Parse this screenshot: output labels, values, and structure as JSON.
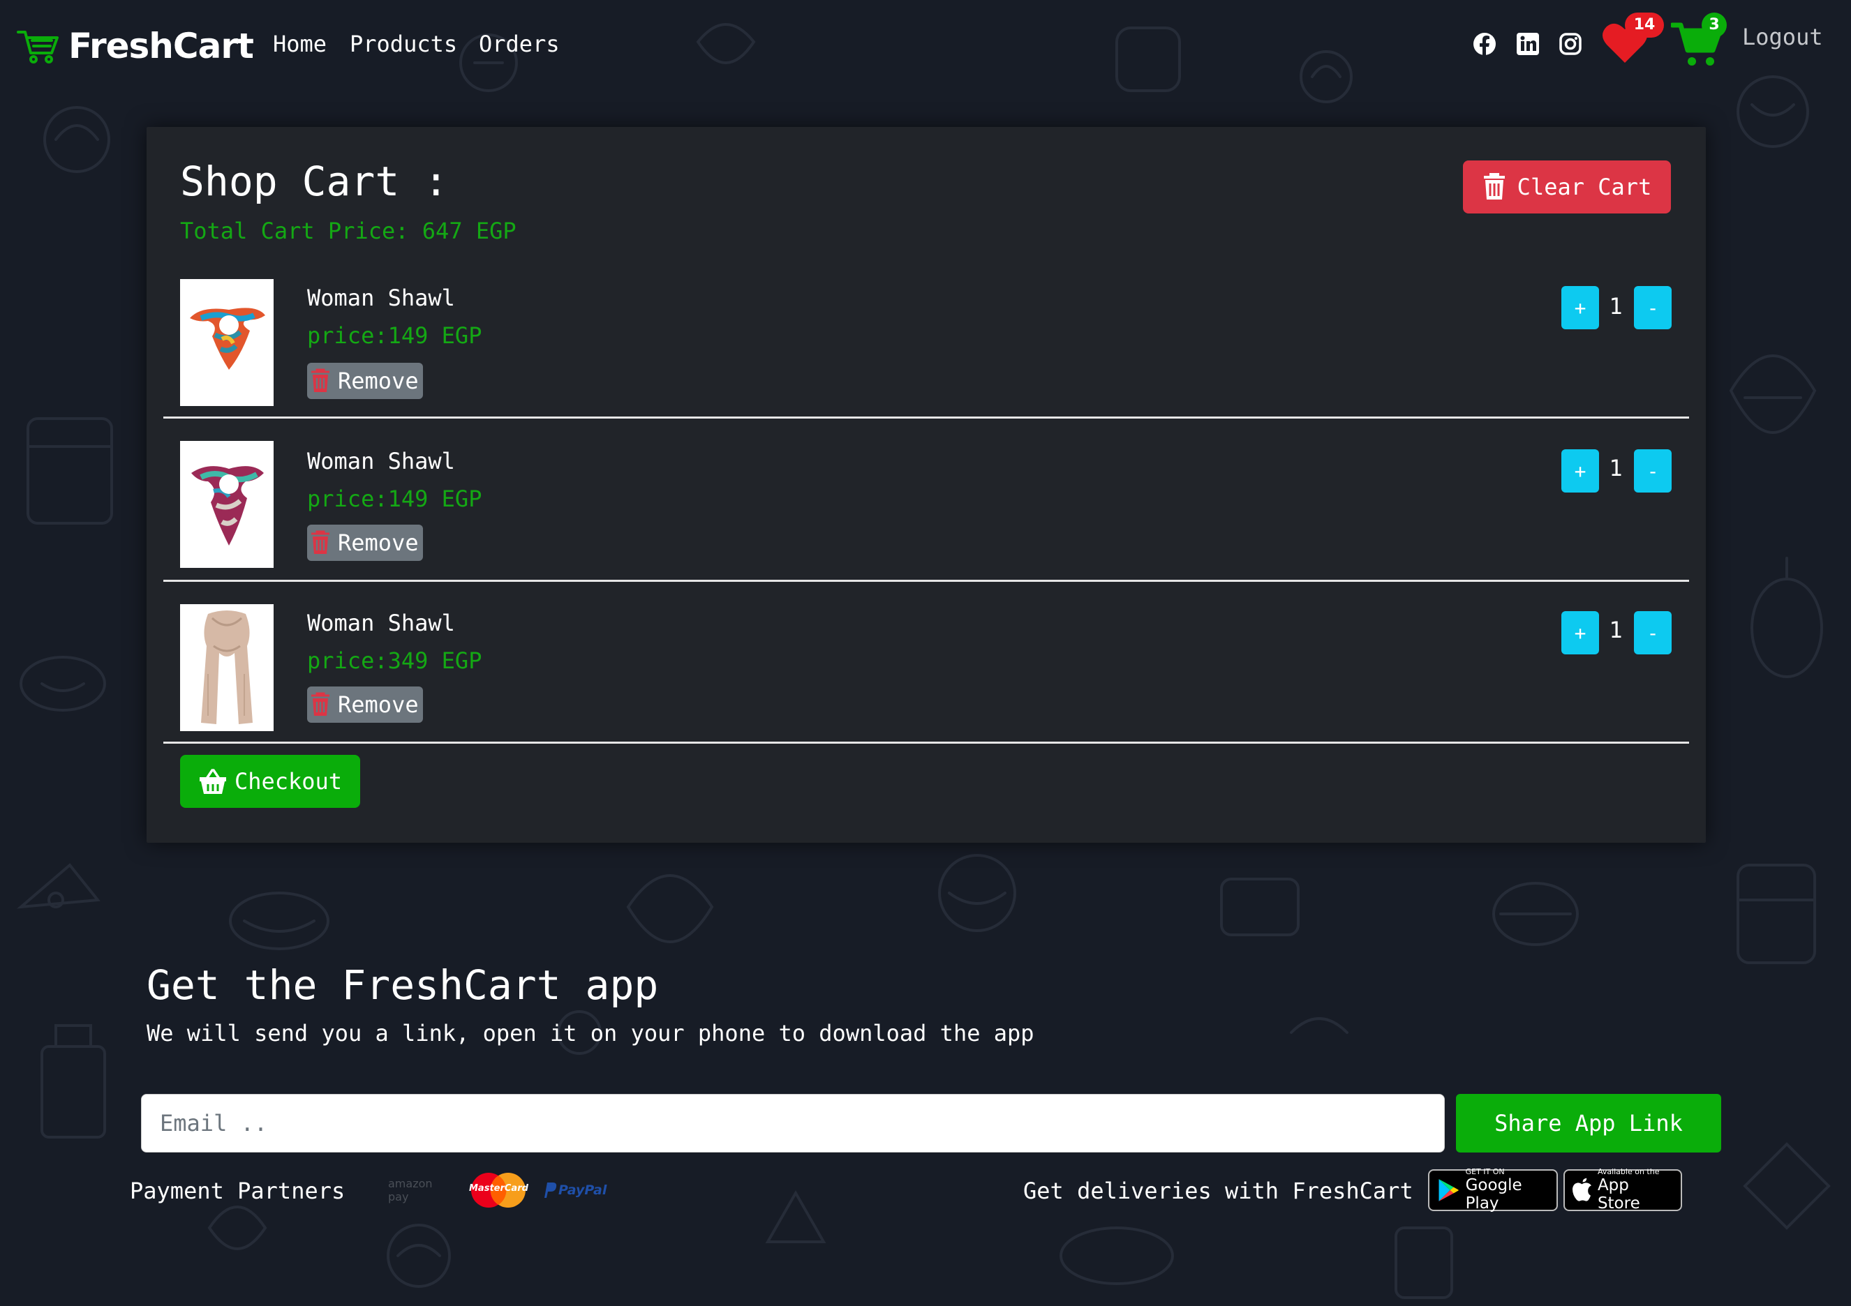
{
  "brand": {
    "name": "FreshCart",
    "accent": "#0aad0a"
  },
  "nav": {
    "links": [
      "Home",
      "Products",
      "Orders"
    ],
    "social_icons": [
      "facebook-icon",
      "linkedin-icon",
      "instagram-icon"
    ],
    "wishlist_count": "14",
    "cart_count": "3",
    "logout": "Logout"
  },
  "cart": {
    "title": "Shop Cart :",
    "total": "Total Cart Price: 647 EGP",
    "clear_label": "Clear Cart",
    "remove_label": "Remove",
    "plus_label": "+",
    "minus_label": "-",
    "items": [
      {
        "name": "Woman Shawl",
        "price": "price:149 EGP",
        "qty": "1"
      },
      {
        "name": "Woman Shawl",
        "price": "price:149 EGP",
        "qty": "1"
      },
      {
        "name": "Woman Shawl",
        "price": "price:349 EGP",
        "qty": "1"
      }
    ],
    "checkout_label": "Checkout"
  },
  "footer": {
    "app_title": "Get the FreshCart app",
    "app_subtitle": "We will send you a link, open it on your phone to download the app",
    "email_placeholder": "Email ..",
    "share_label": "Share App Link",
    "payment_partners": "Payment Partners",
    "partners": [
      "amazon pay",
      "MasterCard",
      "PayPal"
    ],
    "deliveries": "Get deliveries with FreshCart",
    "google_play": {
      "small": "GET IT ON",
      "big": "Google Play"
    },
    "app_store": {
      "small": "Available on the",
      "big": "App Store"
    }
  }
}
